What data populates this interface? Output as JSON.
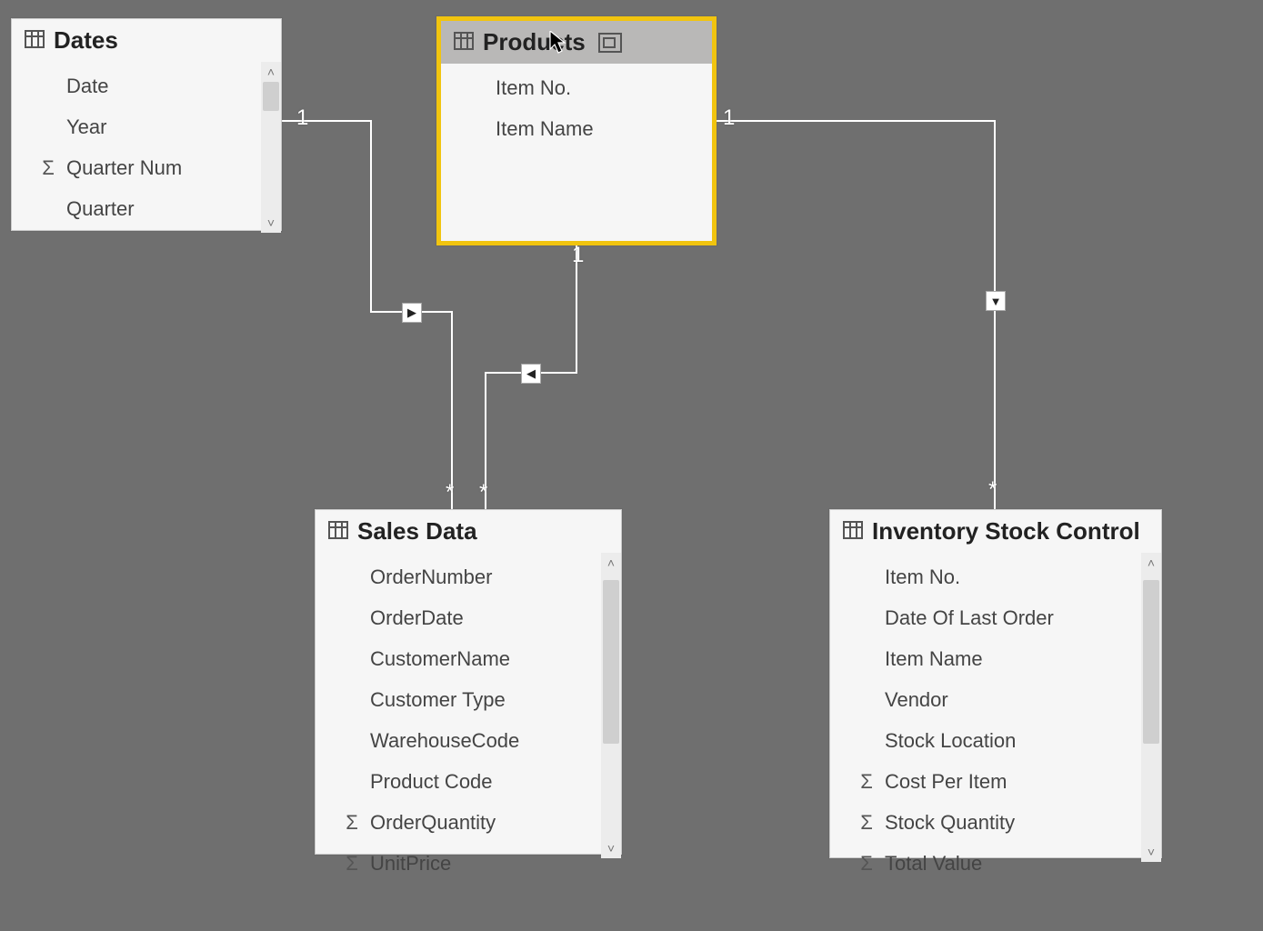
{
  "tables": {
    "dates": {
      "title": "Dates",
      "fields": [
        {
          "label": "Date",
          "sigma": false
        },
        {
          "label": "Year",
          "sigma": false
        },
        {
          "label": "Quarter Num",
          "sigma": true
        },
        {
          "label": "Quarter",
          "sigma": false
        }
      ]
    },
    "products": {
      "title": "Products",
      "fields": [
        {
          "label": "Item No.",
          "sigma": false
        },
        {
          "label": "Item Name",
          "sigma": false
        }
      ]
    },
    "sales": {
      "title": "Sales Data",
      "fields": [
        {
          "label": "OrderNumber",
          "sigma": false
        },
        {
          "label": "OrderDate",
          "sigma": false
        },
        {
          "label": "CustomerName",
          "sigma": false
        },
        {
          "label": "Customer Type",
          "sigma": false
        },
        {
          "label": "WarehouseCode",
          "sigma": false
        },
        {
          "label": "Product Code",
          "sigma": false
        },
        {
          "label": "OrderQuantity",
          "sigma": true
        },
        {
          "label": "UnitPrice",
          "sigma": true
        }
      ]
    },
    "inventory": {
      "title": "Inventory Stock Control",
      "fields": [
        {
          "label": "Item No.",
          "sigma": false
        },
        {
          "label": "Date Of Last Order",
          "sigma": false
        },
        {
          "label": "Item Name",
          "sigma": false
        },
        {
          "label": "Vendor",
          "sigma": false
        },
        {
          "label": "Stock Location",
          "sigma": false
        },
        {
          "label": "Cost Per Item",
          "sigma": true
        },
        {
          "label": "Stock Quantity",
          "sigma": true
        },
        {
          "label": "Total Value",
          "sigma": true
        }
      ]
    }
  },
  "relationships": {
    "dates_to_sales": {
      "from_card": "1",
      "to_card": "*"
    },
    "products_to_sales": {
      "from_card": "1",
      "to_card": "*"
    },
    "products_to_inventory": {
      "from_card": "1",
      "to_card": "*"
    }
  }
}
